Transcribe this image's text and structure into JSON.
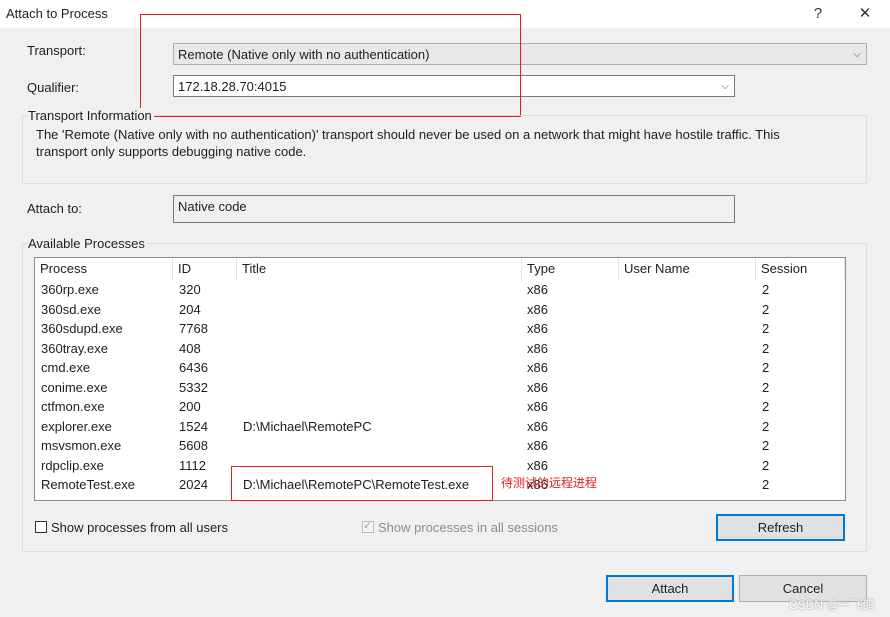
{
  "window": {
    "title": "Attach to Process",
    "help_glyph": "?",
    "close_glyph": "✕"
  },
  "transport": {
    "label": "Transport:",
    "value": "Remote (Native only with no authentication)"
  },
  "qualifier": {
    "label": "Qualifier:",
    "value": "172.18.28.70:4015"
  },
  "transport_info": {
    "heading": "Transport Information",
    "line1": "The 'Remote (Native only with no authentication)' transport should never be used on a network that might have hostile traffic. This",
    "line2": "transport only supports debugging native code."
  },
  "attach_to": {
    "label": "Attach to:",
    "value": "Native code"
  },
  "processes": {
    "heading": "Available Processes",
    "columns": [
      "Process",
      "ID",
      "Title",
      "Type",
      "User Name",
      "Session"
    ],
    "rows": [
      {
        "process": "360rp.exe",
        "id": "320",
        "title": "",
        "type": "x86",
        "user": "",
        "session": "2"
      },
      {
        "process": "360sd.exe",
        "id": "204",
        "title": "",
        "type": "x86",
        "user": "",
        "session": "2"
      },
      {
        "process": "360sdupd.exe",
        "id": "7768",
        "title": "",
        "type": "x86",
        "user": "",
        "session": "2"
      },
      {
        "process": "360tray.exe",
        "id": "408",
        "title": "",
        "type": "x86",
        "user": "",
        "session": "2"
      },
      {
        "process": "cmd.exe",
        "id": "6436",
        "title": "",
        "type": "x86",
        "user": "",
        "session": "2"
      },
      {
        "process": "conime.exe",
        "id": "5332",
        "title": "",
        "type": "x86",
        "user": "",
        "session": "2"
      },
      {
        "process": "ctfmon.exe",
        "id": "200",
        "title": "",
        "type": "x86",
        "user": "",
        "session": "2"
      },
      {
        "process": "explorer.exe",
        "id": "1524",
        "title": "D:\\Michael\\RemotePC",
        "type": "x86",
        "user": "",
        "session": "2"
      },
      {
        "process": "msvsmon.exe",
        "id": "5608",
        "title": "",
        "type": "x86",
        "user": "",
        "session": "2"
      },
      {
        "process": "rdpclip.exe",
        "id": "1112",
        "title": "",
        "type": "x86",
        "user": "",
        "session": "2"
      },
      {
        "process": "RemoteTest.exe",
        "id": "2024",
        "title": "D:\\Michael\\RemotePC\\RemoteTest.exe",
        "type": "x86",
        "user": "",
        "session": "2"
      }
    ]
  },
  "options": {
    "all_users": "Show processes from all users",
    "all_sessions": "Show processes in all sessions"
  },
  "buttons": {
    "refresh": "Refresh",
    "attach": "Attach",
    "cancel": "Cancel"
  },
  "annotation": {
    "note": "待测试的远程进程"
  },
  "watermark": "CSDN @一飞鸽",
  "colors": {
    "annotation_red": "#e02020",
    "primary_border": "#0078d7"
  }
}
